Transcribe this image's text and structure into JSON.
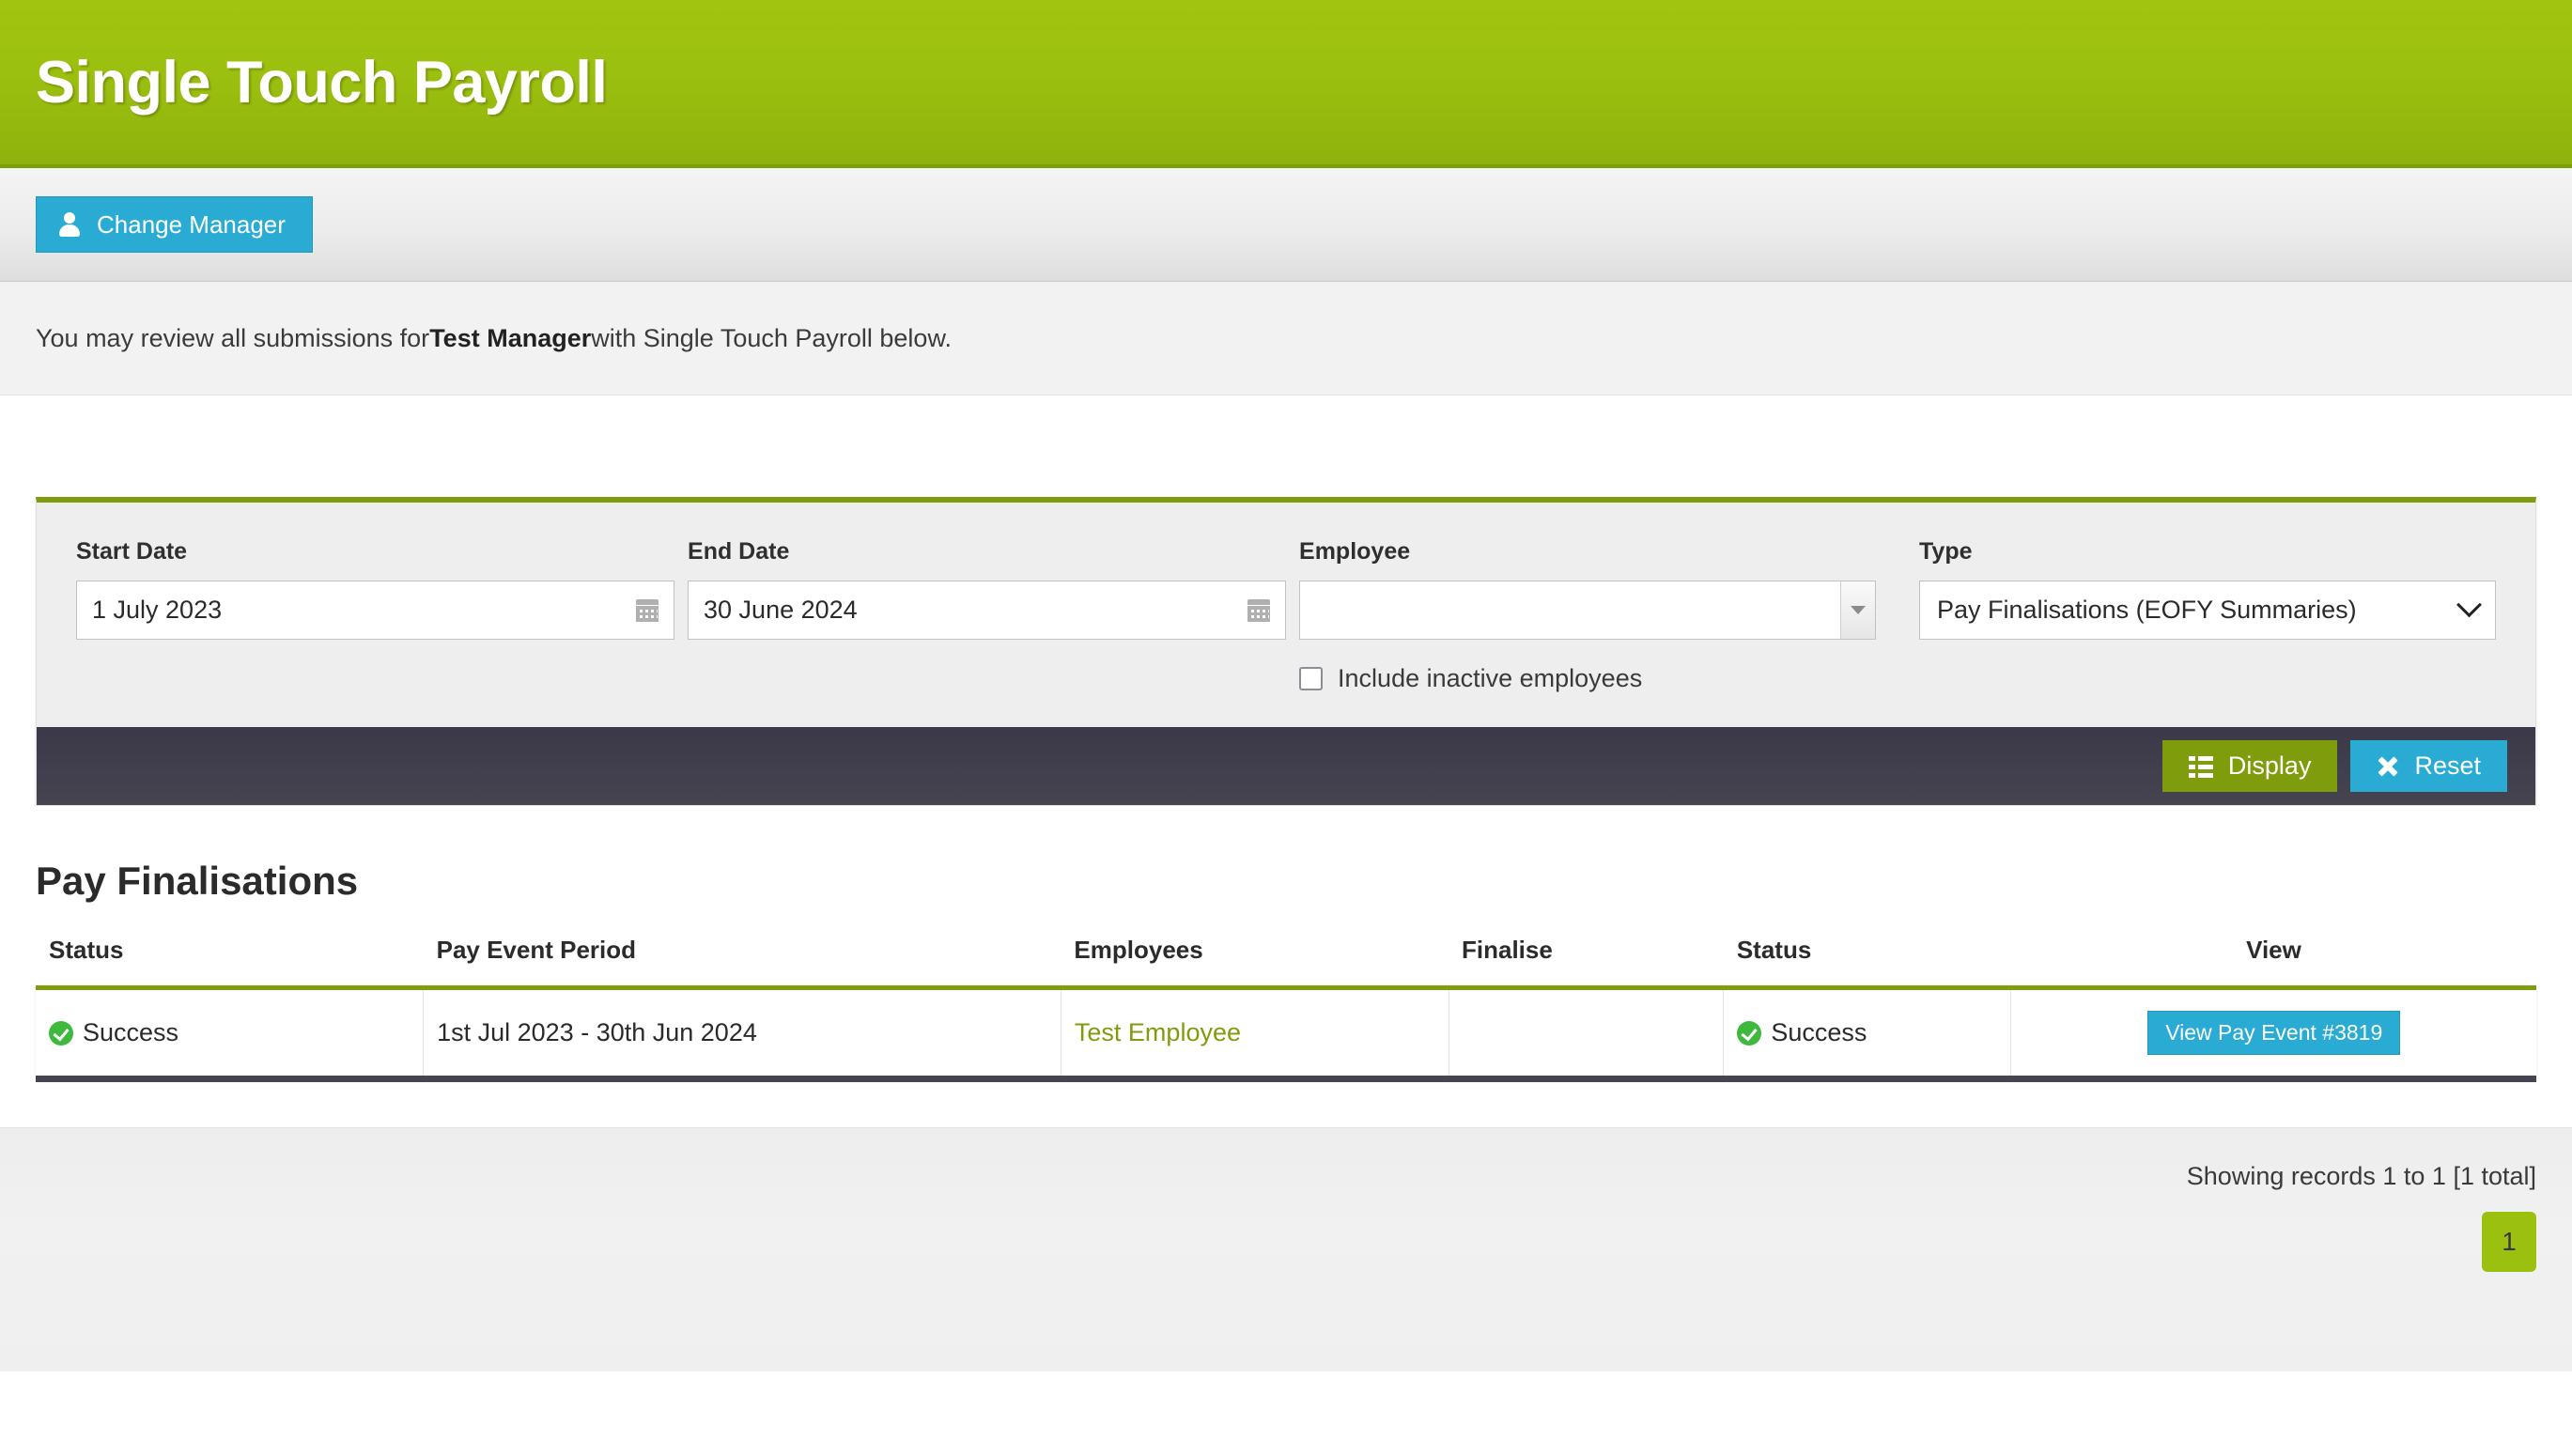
{
  "header": {
    "title": "Single Touch Payroll",
    "bg_color_top": "#a0c40f",
    "bg_color_bottom": "#8fb20d"
  },
  "toolbar": {
    "change_manager_label": "Change Manager",
    "change_manager_color": "#29abd4"
  },
  "intro": {
    "text_before": "You may review all submissions for ",
    "manager_name": "Test Manager",
    "text_after": " with Single Touch Payroll below."
  },
  "filters": {
    "start_date": {
      "label": "Start Date",
      "value": "1 July 2023",
      "placeholder": ""
    },
    "end_date": {
      "label": "End Date",
      "value": "30 June 2024",
      "placeholder": ""
    },
    "employee": {
      "label": "Employee",
      "value": "",
      "placeholder": ""
    },
    "include_inactive": {
      "label": "Include inactive employees",
      "checked": false
    },
    "type": {
      "label": "Type",
      "selected": "Pay Finalisations (EOFY Summaries)",
      "options": [
        "Pay Finalisations (EOFY Summaries)"
      ]
    },
    "accent_color": "#7f9c0c"
  },
  "actions": {
    "display_label": "Display",
    "display_color": "#7f9c0c",
    "reset_label": "Reset",
    "reset_color": "#29abd4",
    "bar_color": "#474451"
  },
  "results": {
    "title": "Pay Finalisations",
    "columns": [
      "Status",
      "Pay Event Period",
      "Employees",
      "Finalise",
      "Status",
      "View"
    ],
    "rows": [
      {
        "status": "Success",
        "period": "1st Jul 2023 - 30th Jun 2024",
        "employees": "Test Employee",
        "finalise": "",
        "status2": "Success",
        "view_label": "View Pay Event #3819"
      }
    ]
  },
  "footer": {
    "showing": "Showing records 1 to 1 [1 total]",
    "pages": [
      "1"
    ],
    "active_page": "1",
    "page_color": "#9cc00f"
  }
}
